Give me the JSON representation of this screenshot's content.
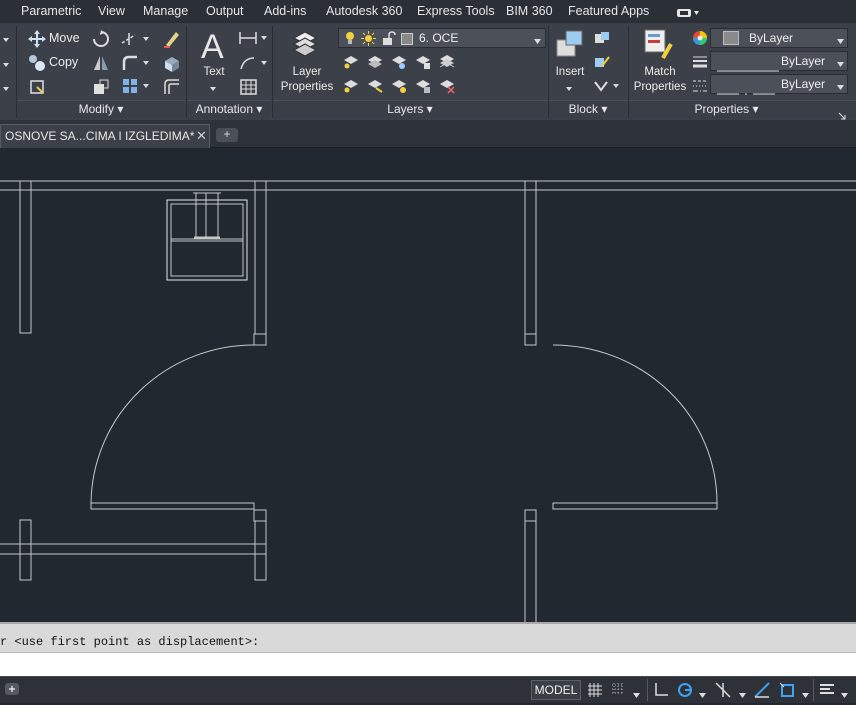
{
  "menubar": {
    "items": [
      "Parametric",
      "View",
      "Manage",
      "Output",
      "Add-ins",
      "Autodesk 360",
      "Express Tools",
      "BIM 360",
      "Featured Apps"
    ]
  },
  "ribbon": {
    "modify": {
      "title": "Modify",
      "move_label": "Move",
      "copy_label": "Copy"
    },
    "annotation": {
      "title": "Annotation",
      "text_label": "Text"
    },
    "layers": {
      "title": "Layers",
      "layer_properties_label_1": "Layer",
      "layer_properties_label_2": "Properties",
      "current_layer": "6. OCE"
    },
    "block": {
      "title": "Block",
      "insert_label": "Insert"
    },
    "properties": {
      "title": "Properties",
      "match_label_1": "Match",
      "match_label_2": "Properties",
      "color_value": "ByLayer",
      "lineweight_value": "ByLayer",
      "linetype_value": "ByLayer"
    }
  },
  "tabs": {
    "document_tab": "OSNOVE SA...CIMA I IZGLEDIMA*",
    "close_glyph": "✕",
    "new_tab_glyph": "+"
  },
  "command": {
    "history_line": "r <use first point as displacement>:",
    "input_value": ""
  },
  "statusbar": {
    "model_label": "MODEL"
  },
  "colors": {
    "canvas_bg": "#212830",
    "ribbon_bg": "#3c4048",
    "line": "#c8c8c8"
  }
}
